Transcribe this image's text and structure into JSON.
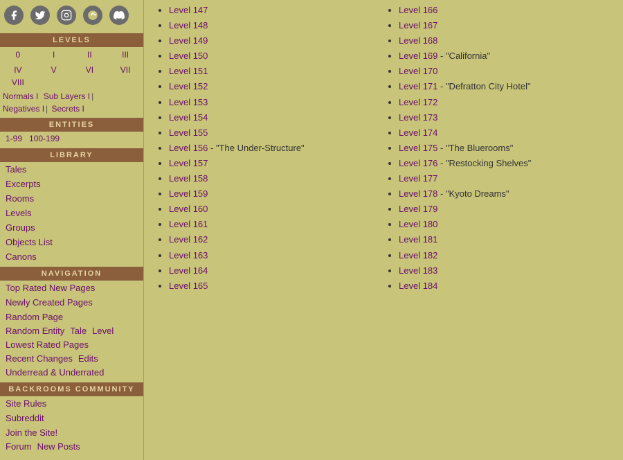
{
  "sidebar": {
    "social_icons": [
      {
        "name": "facebook",
        "symbol": "f"
      },
      {
        "name": "twitter",
        "symbol": "𝕏"
      },
      {
        "name": "instagram",
        "symbol": "◎"
      },
      {
        "name": "reddit",
        "symbol": "👾"
      },
      {
        "name": "discord",
        "symbol": "⌘"
      }
    ],
    "levels_header": "LEVELS",
    "level_nums_row1": [
      "0",
      "I",
      "II",
      "III"
    ],
    "level_nums_row2": [
      "IV",
      "V",
      "VI",
      "VII",
      "VIII"
    ],
    "normals_label": "Normals I",
    "sub_layers_label": "Sub Layers I",
    "sub_layers_sep": "|",
    "negatives_label": "Negatives I",
    "negatives_sep": "|",
    "secrets_label": "Secrets I",
    "entities_header": "ENTITIES",
    "entity_1_99": "1-99",
    "entity_100_199": "100-199",
    "library_header": "LIBRARY",
    "library_links": [
      "Tales",
      "Excerpts",
      "Rooms",
      "Levels",
      "Groups",
      "Objects List",
      "Canons"
    ],
    "canons_label": "Canons",
    "navigation_header": "NAVIGATION",
    "nav_links": [
      "Top Rated New Pages",
      "Newly Created Pages",
      "Random Page"
    ],
    "nav_multi": [
      "Random Entity",
      "Tale",
      "Level"
    ],
    "lowest_label": "Lowest Rated Pages",
    "recent_label": "Recent Changes",
    "edits_label": "Edits",
    "underrated_label": "Underread & Underrated",
    "community_header": "BACKROOMS COMMUNITY",
    "community_links": [
      "Site Rules",
      "Subreddit",
      "Join the Site!"
    ],
    "footer_links": [
      "Forum",
      "New Posts"
    ]
  },
  "main": {
    "levels": [
      {
        "id": "Level 147",
        "desc": ""
      },
      {
        "id": "Level 148",
        "desc": ""
      },
      {
        "id": "Level 149",
        "desc": ""
      },
      {
        "id": "Level 150",
        "desc": ""
      },
      {
        "id": "Level 151",
        "desc": ""
      },
      {
        "id": "Level 152",
        "desc": ""
      },
      {
        "id": "Level 153",
        "desc": ""
      },
      {
        "id": "Level 154",
        "desc": ""
      },
      {
        "id": "Level 155",
        "desc": ""
      },
      {
        "id": "Level 156",
        "desc": "- \"The Under-Structure\""
      },
      {
        "id": "Level 157",
        "desc": ""
      },
      {
        "id": "Level 158",
        "desc": ""
      },
      {
        "id": "Level 159",
        "desc": ""
      },
      {
        "id": "Level 160",
        "desc": ""
      },
      {
        "id": "Level 161",
        "desc": ""
      },
      {
        "id": "Level 162",
        "desc": ""
      },
      {
        "id": "Level 163",
        "desc": ""
      },
      {
        "id": "Level 164",
        "desc": ""
      },
      {
        "id": "Level 165",
        "desc": ""
      },
      {
        "id": "Level 166",
        "desc": ""
      },
      {
        "id": "Level 167",
        "desc": ""
      },
      {
        "id": "Level 168",
        "desc": ""
      },
      {
        "id": "Level 169",
        "desc": "- \"California\""
      },
      {
        "id": "Level 170",
        "desc": ""
      },
      {
        "id": "Level 171",
        "desc": "- \"Defratton City Hotel\""
      },
      {
        "id": "Level 172",
        "desc": ""
      },
      {
        "id": "Level 173",
        "desc": ""
      },
      {
        "id": "Level 174",
        "desc": ""
      },
      {
        "id": "Level 175",
        "desc": "- \"The Bluerooms\""
      },
      {
        "id": "Level 176",
        "desc": "- \"Restocking Shelves\""
      },
      {
        "id": "Level 177",
        "desc": ""
      },
      {
        "id": "Level 178",
        "desc": "- \"Kyoto Dreams\""
      },
      {
        "id": "Level 179",
        "desc": ""
      },
      {
        "id": "Level 180",
        "desc": ""
      },
      {
        "id": "Level 181",
        "desc": ""
      },
      {
        "id": "Level 182",
        "desc": ""
      },
      {
        "id": "Level 183",
        "desc": ""
      },
      {
        "id": "Level 184",
        "desc": ""
      }
    ]
  }
}
